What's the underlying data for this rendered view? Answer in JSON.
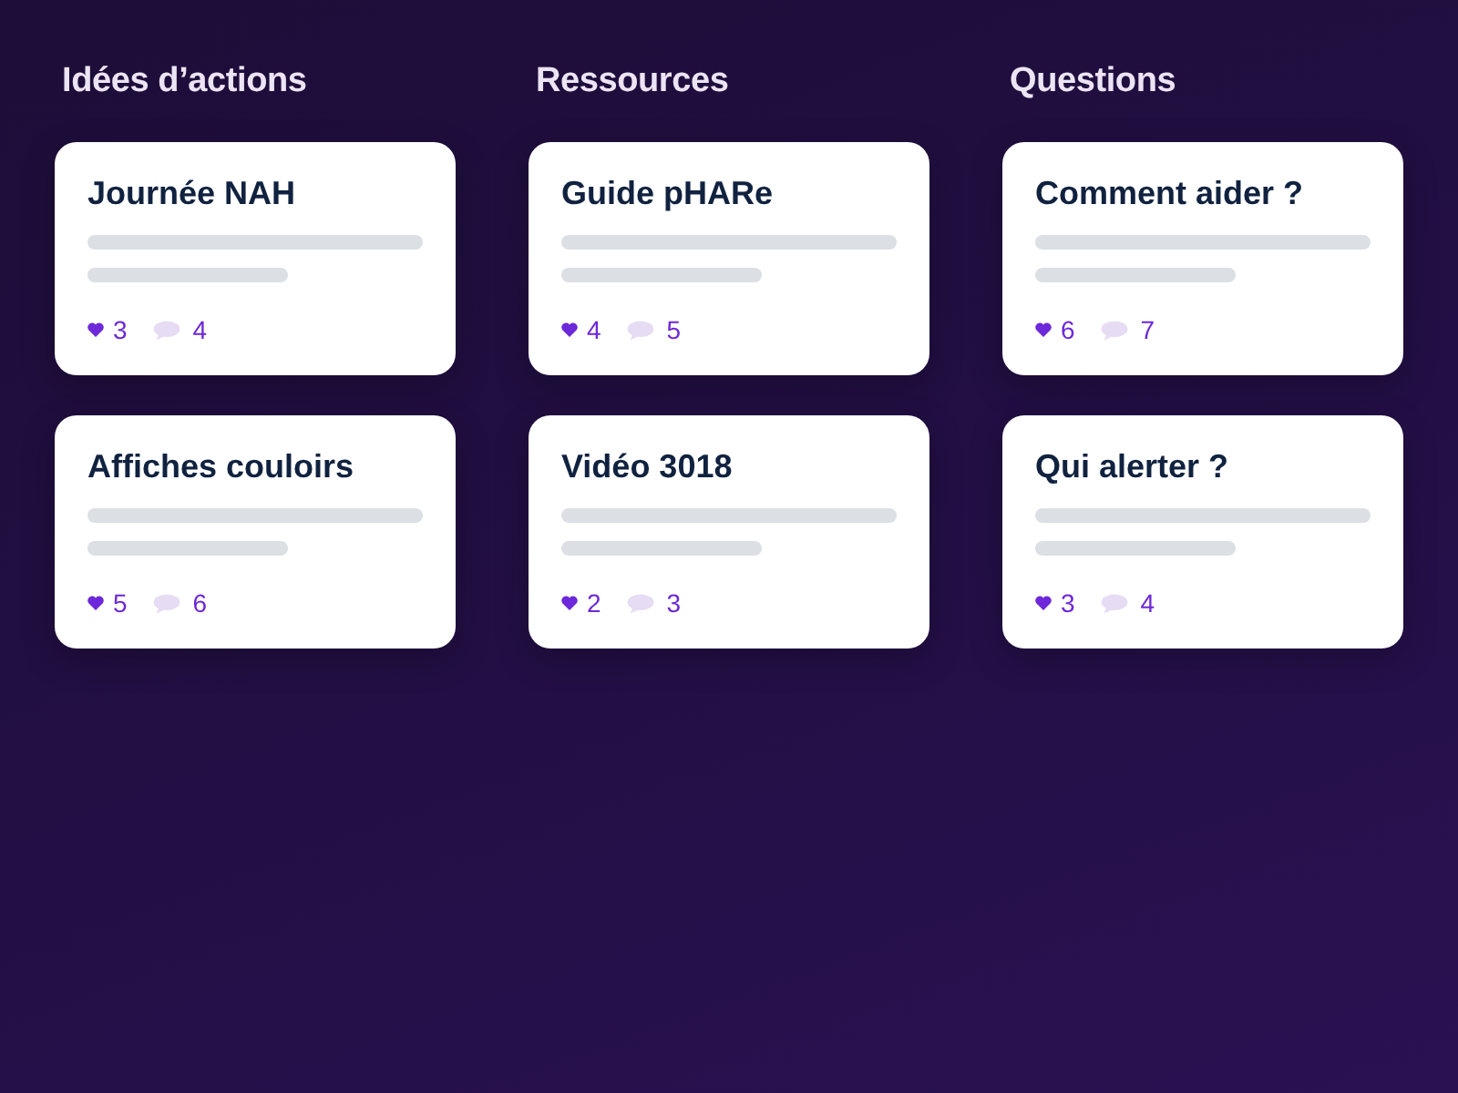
{
  "columns": [
    {
      "title": "Idées d’actions",
      "cards": [
        {
          "title": "Journée NAH",
          "likes": "3",
          "comments": "4"
        },
        {
          "title": "Affiches couloirs",
          "likes": "5",
          "comments": "6"
        }
      ]
    },
    {
      "title": "Ressources",
      "cards": [
        {
          "title": "Guide pHARe",
          "likes": "4",
          "comments": "5"
        },
        {
          "title": "Vidéo 3018",
          "likes": "2",
          "comments": "3"
        }
      ]
    },
    {
      "title": "Questions",
      "cards": [
        {
          "title": "Comment aider ?",
          "likes": "6",
          "comments": "7"
        },
        {
          "title": "Qui alerter ?",
          "likes": "3",
          "comments": "4"
        }
      ]
    }
  ]
}
